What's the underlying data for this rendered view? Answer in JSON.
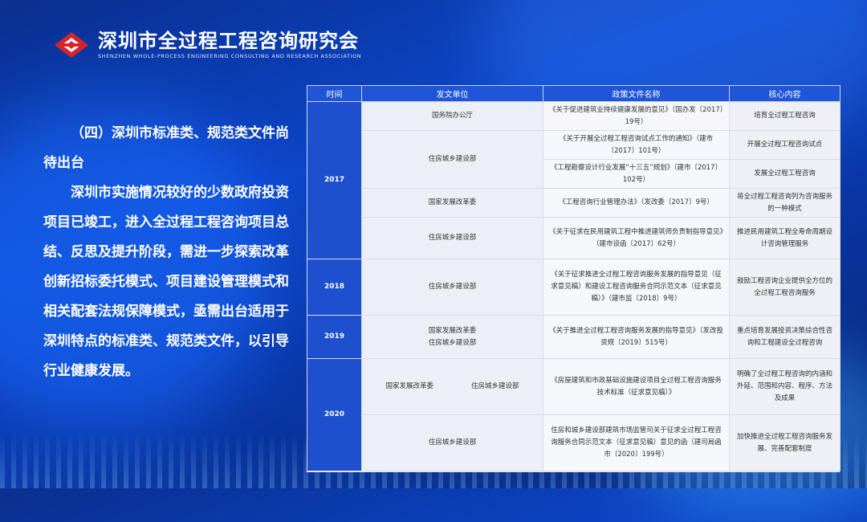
{
  "header": {
    "title": "深圳市全过程工程咨询研究会",
    "subtitle": "SHENZHEN WHOLE-PROCESS ENGINEERING CONSULTING AND RESEARCH ASSOCIATION",
    "brand_color": "#d7242a"
  },
  "left": {
    "heading": "（四）深圳市标准类、规范类文件尚待出台",
    "body": "深圳市实施情况较好的少数政府投资项目已竣工，进入全过程工程咨询项目总结、反思及提升阶段，需进一步探索改革创新招标委托模式、项目建设管理模式和相关配套法规保障模式，亟需出台适用于深圳特点的标准类、规范类文件，以引导行业健康发展。"
  },
  "table": {
    "headers": [
      "时间",
      "发文单位",
      "政策文件名称",
      "核心内容"
    ],
    "years": [
      "2017",
      "2018",
      "2019",
      "2020"
    ],
    "rows": [
      {
        "unit": "国务院办公厅",
        "doc": "《关于促进建筑业持续健康发展的意见》（国办发〔2017〕19号）",
        "core": "培育全过程工程咨询"
      },
      {
        "unit": "住房城乡建设部",
        "doc": "《关于开展全过程工程咨询试点工作的通知》（建市〔2017〕101号）",
        "core": "开展全过程工程咨询试点"
      },
      {
        "unit": "",
        "doc": "《工程勘察设计行业发展“十三五”规划》（建市〔2017〕102号）",
        "core": "发展全过程工程咨询"
      },
      {
        "unit": "国家发展改革委",
        "doc": "《工程咨询行业管理办法》（发改委〔2017〕9号）",
        "core": "将全过程工程咨询列为咨询服务的一种模式"
      },
      {
        "unit": "住房城乡建设部",
        "doc": "《关于征求在民用建筑工程中推进建筑师负责制指导意见》（建市设函〔2017〕62号）",
        "core": "推进民用建筑工程全寿命周期设计咨询管理服务"
      },
      {
        "unit": "住房城乡建设部",
        "doc": "《关于征求推进全过程工程咨询服务发展的指导意见（征求意见稿）和建设工程咨询服务合同示范文本（征求意见稿）》（建市监〔2018〕9号）",
        "core": "鼓励工程咨询企业提供全方位的全过程工程咨询服务"
      },
      {
        "unit": "国家发展改革委",
        "unit2": "住房城乡建设部",
        "doc": "《关于推进全过程工程咨询服务发展的指导意见》（发改投资规〔2019〕515号）",
        "core": "重点培育发展投资决策综合性咨询和工程建设全过程咨询"
      },
      {
        "unit": "国家发展改革委",
        "unit2": "住房城乡建设部",
        "doc": "《房屋建筑和市政基础设施建设项目全过程工程咨询服务技术标准（征求意见稿）》",
        "core": "明确了全过程工程咨询的内涵和外延、范围和内容、程序、方法及成果"
      },
      {
        "unit": "住房城乡建设部",
        "doc": "住房和城乡建设部建筑市场监管司关于征求全过程工程咨询服务合同示范文本（征求意见稿）意见的函（建司局函市〔2020〕199号）",
        "core": "加快推进全过程工程咨询服务发展、完善配套制度"
      }
    ]
  }
}
